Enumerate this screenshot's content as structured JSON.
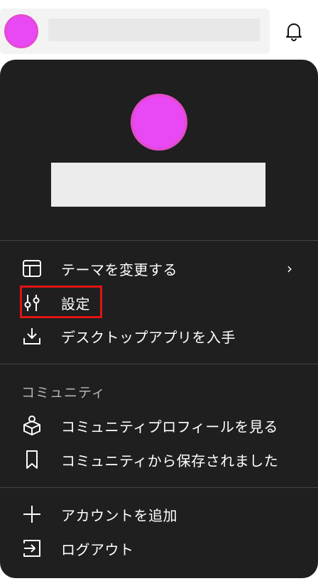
{
  "menu": {
    "items": [
      {
        "label": "テーマを変更する",
        "chevron": "›",
        "icon": "layout-icon"
      },
      {
        "label": "設定",
        "icon": "sliders-icon"
      },
      {
        "label": "デスクトップアプリを入手",
        "icon": "download-icon"
      }
    ]
  },
  "community": {
    "section_label": "コミュニティ",
    "items": [
      {
        "label": "コミュニティプロフィールを見る",
        "icon": "cube-person-icon"
      },
      {
        "label": "コミュニティから保存されました",
        "icon": "bookmark-icon"
      }
    ]
  },
  "account": {
    "items": [
      {
        "label": "アカウントを追加",
        "icon": "plus-icon"
      },
      {
        "label": "ログアウト",
        "icon": "logout-icon"
      }
    ]
  },
  "colors": {
    "panel": "#1f1f1f",
    "avatar": "#e948f5",
    "highlight": "#e11414"
  }
}
